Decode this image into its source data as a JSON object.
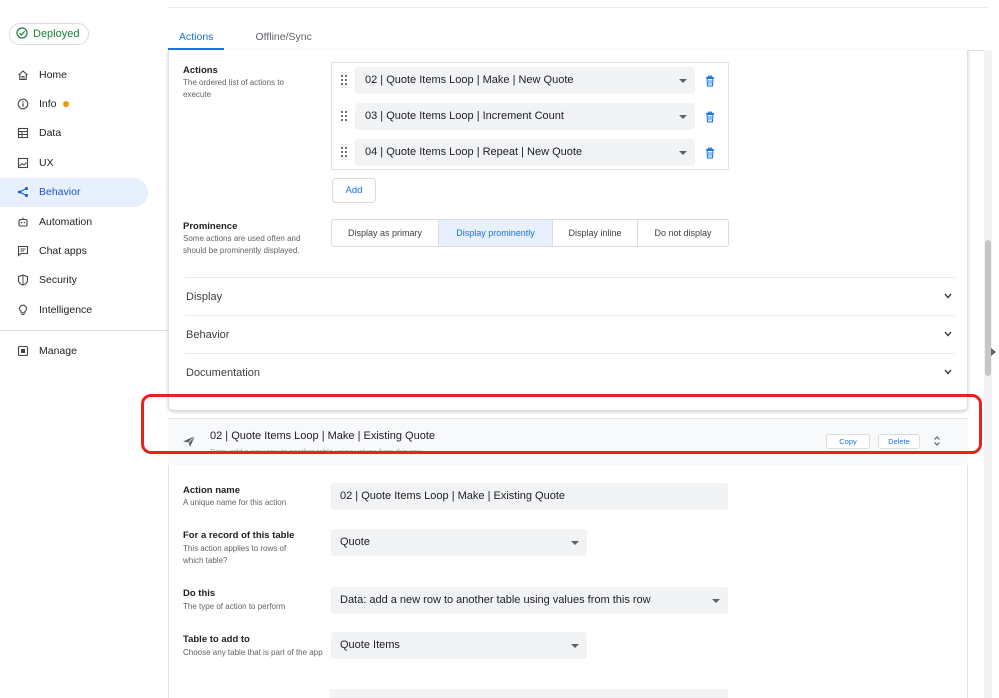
{
  "status_chip": {
    "label": "Deployed",
    "color": "#188038"
  },
  "sidebar": {
    "items": [
      {
        "label": "Home",
        "icon": "home-icon"
      },
      {
        "label": "Info",
        "icon": "info-icon",
        "dot_color": "#f29900"
      },
      {
        "label": "Data",
        "icon": "table-icon"
      },
      {
        "label": "UX",
        "icon": "picture-icon"
      },
      {
        "label": "Behavior",
        "icon": "share-icon",
        "active": true
      },
      {
        "label": "Automation",
        "icon": "robot-icon"
      },
      {
        "label": "Chat apps",
        "icon": "chat-icon"
      },
      {
        "label": "Security",
        "icon": "shield-icon"
      },
      {
        "label": "Intelligence",
        "icon": "lightbulb-icon"
      }
    ],
    "bottom": {
      "label": "Manage",
      "icon": "manage-icon"
    }
  },
  "tabs": [
    {
      "label": "Actions",
      "active": true
    },
    {
      "label": "Offline/Sync",
      "active": false
    }
  ],
  "action_card": {
    "actions_label": "Actions",
    "actions_help": "The ordered list of actions to execute",
    "action_items": [
      "02 | Quote Items Loop | Make | New Quote",
      "03 | Quote Items Loop | Increment Count",
      "04 | Quote Items Loop | Repeat | New Quote"
    ],
    "add_label": "Add",
    "prominence_label": "Prominence",
    "prominence_help": "Some actions are used often and should be prominently displayed.",
    "prominence_options": [
      "Display as primary",
      "Display prominently",
      "Display inline",
      "Do not display"
    ],
    "prominence_selected": "Display prominently",
    "sections": [
      "Display",
      "Behavior",
      "Documentation"
    ]
  },
  "action2": {
    "title": "02 | Quote Items Loop | Make | Existing Quote",
    "description": "Data: add a new row to another table using values from this row",
    "copy_label": "Copy",
    "delete_label": "Delete",
    "fields": {
      "action_name_label": "Action name",
      "action_name_help": "A unique name for this action",
      "action_name_value": "02 | Quote Items Loop | Make | Existing Quote",
      "table_label": "For a record of this table",
      "table_help": "This action applies to rows of which table?",
      "table_value": "Quote",
      "do_this_label": "Do this",
      "do_this_help": "The type of action to perform",
      "do_this_value": "Data: add a new row to another table using values from this row",
      "table_add_label": "Table to add to",
      "table_add_help": "Choose any table that is part of the app",
      "table_add_value": "Quote Items"
    }
  },
  "colors": {
    "accent": "#1a73e8",
    "highlight": "#e8231c",
    "active_bg": "#e8f0fe"
  }
}
